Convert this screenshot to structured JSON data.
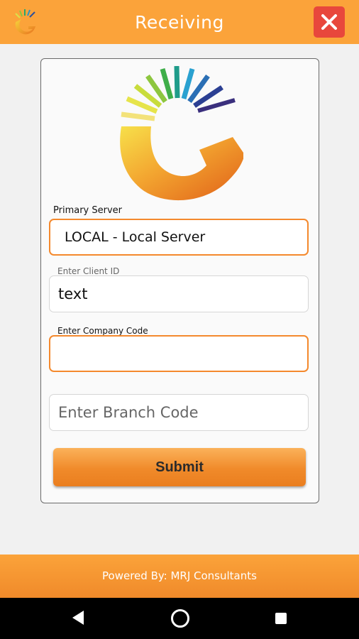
{
  "header": {
    "title": "Receiving",
    "close_icon": "close-icon",
    "logo_icon": "company-logo"
  },
  "form": {
    "primary_server_label": "Primary Server",
    "primary_server_value": "LOCAL - Local Server",
    "client_id_label": "Enter Client ID",
    "client_id_value": "text",
    "company_code_label": "Enter Company Code",
    "company_code_value": "",
    "branch_code_placeholder": "Enter Branch Code",
    "submit_label": "Submit"
  },
  "footer": {
    "text": "Powered By: MRJ Consultants"
  },
  "navbar": {
    "back_icon": "back-icon",
    "home_icon": "home-icon",
    "recent_icon": "recent-apps-icon"
  },
  "colors": {
    "accent": "#fba33a",
    "close": "#e8473c",
    "field_focus": "#f4892d"
  }
}
